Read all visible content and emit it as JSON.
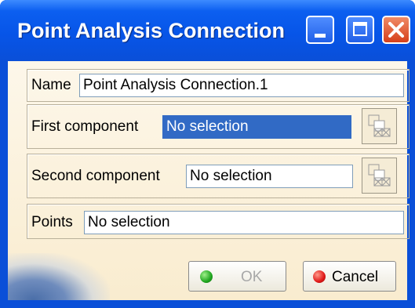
{
  "window": {
    "title": "Point Analysis Connection",
    "controls": [
      "minimize-icon",
      "maximize-icon",
      "close-icon"
    ]
  },
  "name": {
    "label": "Name",
    "value": "Point Analysis Connection.1"
  },
  "first_component": {
    "label": "First component",
    "value": "No selection",
    "selected": true
  },
  "second_component": {
    "label": "Second component",
    "value": "No selection"
  },
  "points": {
    "label": "Points",
    "value": "No selection"
  },
  "buttons": {
    "ok": "OK",
    "ok_enabled": false,
    "cancel": "Cancel"
  },
  "colors": {
    "title_bar": "#0a4fd8",
    "selection": "#316ac5",
    "close_button": "#d6401a"
  }
}
